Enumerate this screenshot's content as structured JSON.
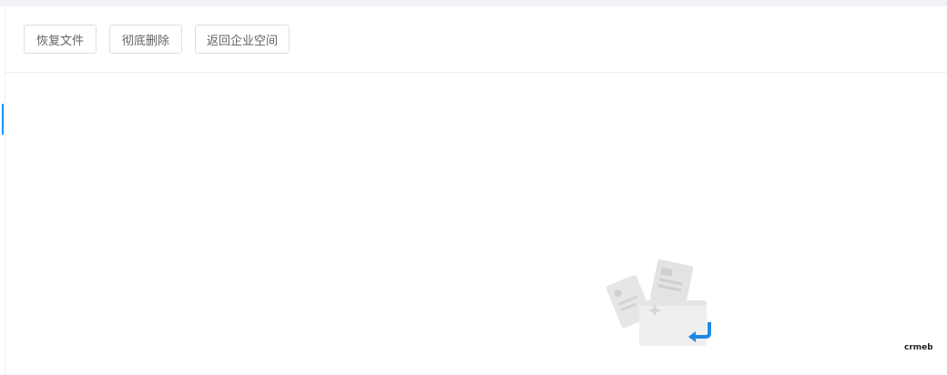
{
  "toolbar": {
    "restore_label": "恢复文件",
    "delete_label": "彻底删除",
    "back_label": "返回企业空间"
  },
  "branding": {
    "logo_text": "crmeb"
  },
  "colors": {
    "accent": "#1890ff",
    "border": "#dcdfe6",
    "top_strip": "#f0f2f5"
  },
  "icons": {
    "empty_state": "empty-recycle-folder-icon",
    "logo": "crmeb-logo"
  }
}
